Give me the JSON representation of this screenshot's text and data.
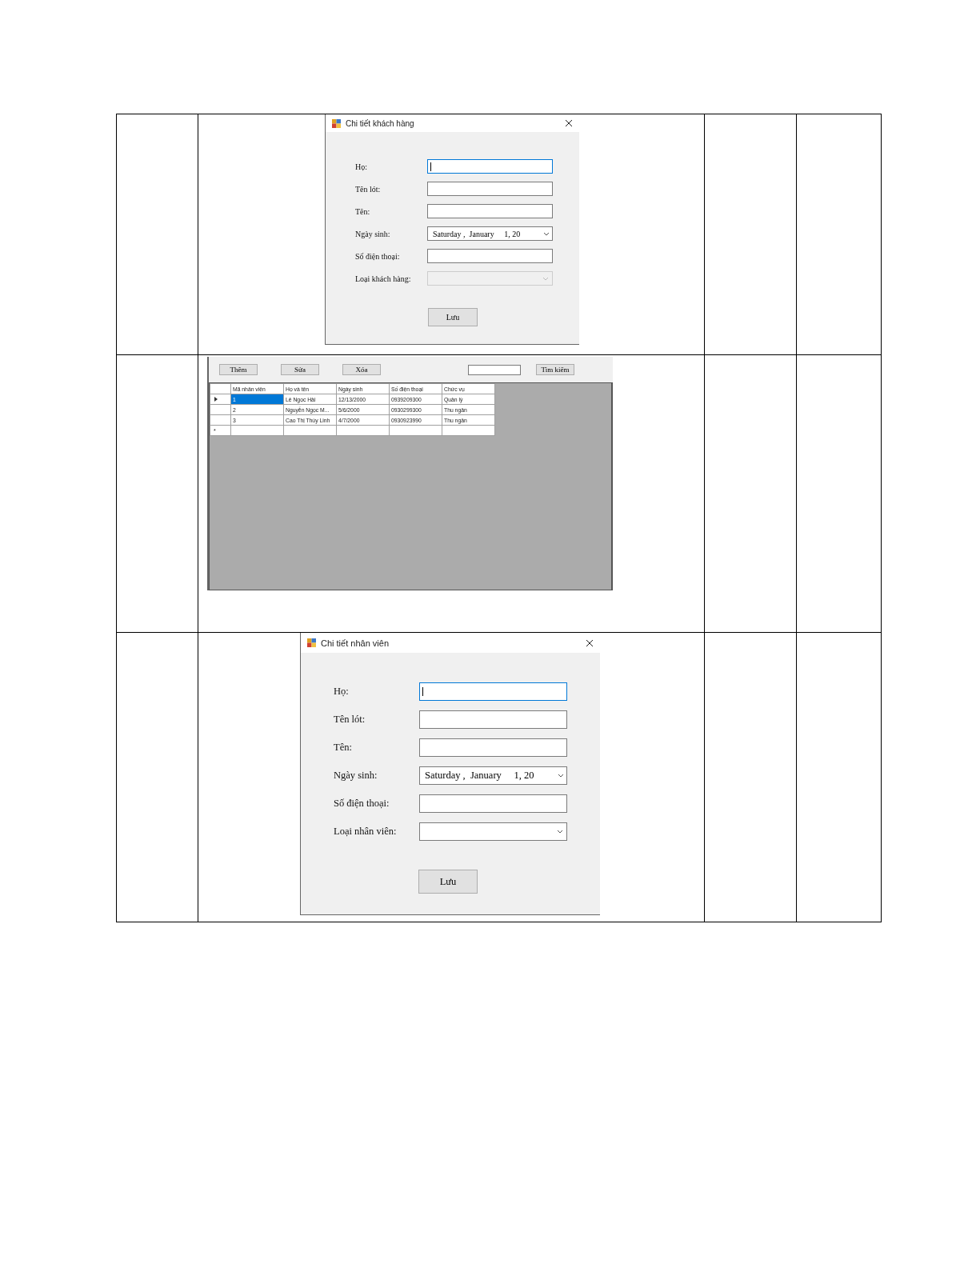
{
  "rows": [
    {
      "kind": "dialog",
      "title": "Chi tiết khách hàng",
      "fields": [
        {
          "label": "Họ:",
          "kind": "text",
          "focused": true,
          "disabled": false
        },
        {
          "label": "Tên lót:",
          "kind": "text",
          "focused": false,
          "disabled": false
        },
        {
          "label": "Tên:",
          "kind": "text",
          "focused": false,
          "disabled": false
        },
        {
          "label": "Ngày sinh:",
          "kind": "date",
          "value": "Saturday ,  January     1, 20",
          "focused": false,
          "disabled": false
        },
        {
          "label": "Số điện thoại:",
          "kind": "text",
          "focused": false,
          "disabled": false
        },
        {
          "label": "Loại khách hàng:",
          "kind": "combo",
          "focused": false,
          "disabled": true
        }
      ],
      "button": "Lưu"
    },
    {
      "kind": "grid_form",
      "buttons": [
        "Thêm",
        "Sửa",
        "Xóa"
      ],
      "search_button": "Tìm kiếm",
      "columns": [
        "Mã nhân viên",
        "Họ và tên",
        "Ngày sinh",
        "Số điện thoại",
        "Chức vụ"
      ],
      "records": [
        {
          "cells": [
            "1",
            "Lê Ngọc Hải",
            "12/13/2000",
            "0939209300",
            "Quản lý"
          ],
          "selected": true
        },
        {
          "cells": [
            "2",
            "Nguyễn Ngọc M...",
            "5/6/2000",
            "0930299300",
            "Thu ngân"
          ],
          "selected": false
        },
        {
          "cells": [
            "3",
            "Cao Thị Thùy Linh",
            "4/7/2000",
            "0930923990",
            "Thu ngân"
          ],
          "selected": false
        }
      ],
      "new_row_marker": "*"
    },
    {
      "kind": "dialog",
      "title": "Chi tiết nhân viên",
      "fields": [
        {
          "label": "Họ:",
          "kind": "text",
          "focused": true,
          "disabled": false
        },
        {
          "label": "Tên lót:",
          "kind": "text",
          "focused": false,
          "disabled": false
        },
        {
          "label": "Tên:",
          "kind": "text",
          "focused": false,
          "disabled": false
        },
        {
          "label": "Ngày sinh:",
          "kind": "date",
          "value": "Saturday ,  January     1, 20",
          "focused": false,
          "disabled": false
        },
        {
          "label": "Số điện thoại:",
          "kind": "text",
          "focused": false,
          "disabled": false
        },
        {
          "label": "Loại nhân viên:",
          "kind": "combo",
          "focused": false,
          "disabled": false
        }
      ],
      "button": "Lưu"
    }
  ]
}
